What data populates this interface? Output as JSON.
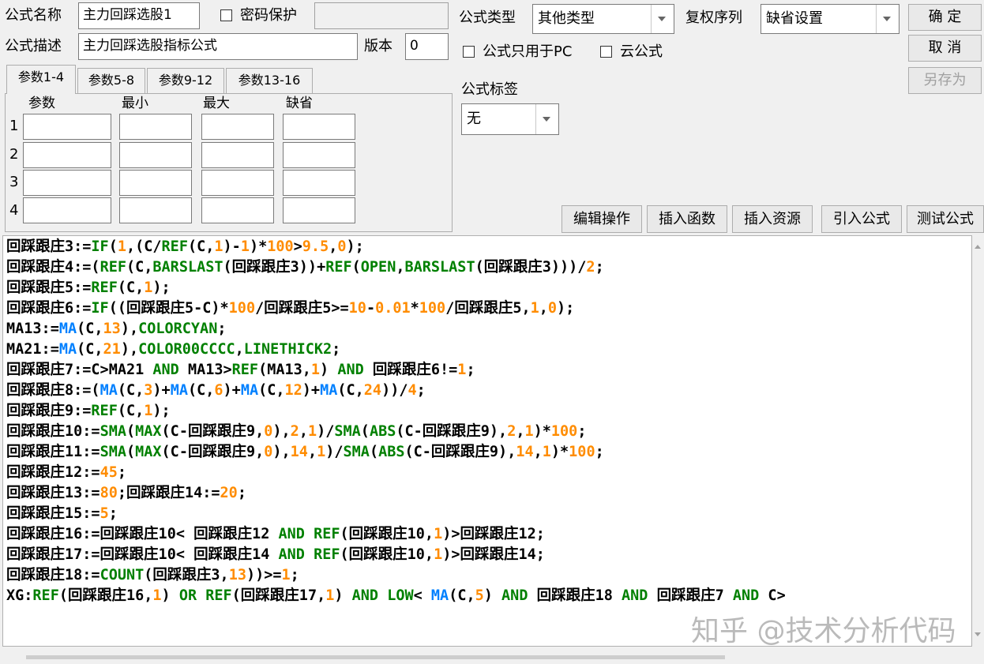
{
  "header": {
    "name_label": "公式名称",
    "name_value": "主力回踩选股1",
    "password_label": "密码保护",
    "password_value": "",
    "desc_label": "公式描述",
    "desc_value": "主力回踩选股指标公式",
    "version_label": "版本",
    "version_value": "0"
  },
  "right": {
    "type_label": "公式类型",
    "type_value": "其他类型",
    "restore_label": "复权序列",
    "restore_value": "缺省设置",
    "pc_only_label": "公式只用于PC",
    "cloud_label": "云公式",
    "tag_label": "公式标签",
    "tag_value": "无"
  },
  "buttons": {
    "ok": "确  定",
    "cancel": "取  消",
    "save_as": "另存为",
    "edit_ops": "编辑操作",
    "insert_func": "插入函数",
    "insert_res": "插入资源",
    "import_formula": "引入公式",
    "test_formula": "测试公式"
  },
  "params": {
    "tabs": [
      "参数1-4",
      "参数5-8",
      "参数9-12",
      "参数13-16"
    ],
    "columns": [
      "参数",
      "最小",
      "最大",
      "缺省"
    ],
    "rows": [
      "1",
      "2",
      "3",
      "4"
    ]
  },
  "code_lines": [
    [
      [
        "t",
        "回踩跟庄3:="
      ],
      [
        "k",
        "IF"
      ],
      [
        "t",
        "("
      ],
      [
        "n",
        "1"
      ],
      [
        "t",
        ",(C/"
      ],
      [
        "k",
        "REF"
      ],
      [
        "t",
        "(C,"
      ],
      [
        "n",
        "1"
      ],
      [
        "t",
        ")-"
      ],
      [
        "n",
        "1"
      ],
      [
        "t",
        ")*"
      ],
      [
        "n",
        "100"
      ],
      [
        "t",
        ">"
      ],
      [
        "n",
        "9.5"
      ],
      [
        "t",
        ","
      ],
      [
        "n",
        "0"
      ],
      [
        "t",
        ");"
      ]
    ],
    [
      [
        "t",
        "回踩跟庄4:=("
      ],
      [
        "k",
        "REF"
      ],
      [
        "t",
        "(C,"
      ],
      [
        "k",
        "BARSLAST"
      ],
      [
        "t",
        "(回踩跟庄3))+"
      ],
      [
        "k",
        "REF"
      ],
      [
        "t",
        "("
      ],
      [
        "k",
        "OPEN"
      ],
      [
        "t",
        ","
      ],
      [
        "k",
        "BARSLAST"
      ],
      [
        "t",
        "(回踩跟庄3)))/"
      ],
      [
        "n",
        "2"
      ],
      [
        "t",
        ";"
      ]
    ],
    [
      [
        "t",
        "回踩跟庄5:="
      ],
      [
        "k",
        "REF"
      ],
      [
        "t",
        "(C,"
      ],
      [
        "n",
        "1"
      ],
      [
        "t",
        ");"
      ]
    ],
    [
      [
        "t",
        "回踩跟庄6:="
      ],
      [
        "k",
        "IF"
      ],
      [
        "t",
        "((回踩跟庄5-C)*"
      ],
      [
        "n",
        "100"
      ],
      [
        "t",
        "/回踩跟庄5>="
      ],
      [
        "n",
        "10"
      ],
      [
        "t",
        "-"
      ],
      [
        "n",
        "0.01"
      ],
      [
        "t",
        "*"
      ],
      [
        "n",
        "100"
      ],
      [
        "t",
        "/回踩跟庄5,"
      ],
      [
        "n",
        "1"
      ],
      [
        "t",
        ","
      ],
      [
        "n",
        "0"
      ],
      [
        "t",
        ");"
      ]
    ],
    [
      [
        "t",
        "MA13:="
      ],
      [
        "f",
        "MA"
      ],
      [
        "t",
        "(C,"
      ],
      [
        "n",
        "13"
      ],
      [
        "t",
        "),"
      ],
      [
        "k",
        "COLORCYAN"
      ],
      [
        "t",
        ";"
      ]
    ],
    [
      [
        "t",
        "MA21:="
      ],
      [
        "f",
        "MA"
      ],
      [
        "t",
        "(C,"
      ],
      [
        "n",
        "21"
      ],
      [
        "t",
        "),"
      ],
      [
        "k",
        "COLOR00CCCC"
      ],
      [
        "t",
        ","
      ],
      [
        "k",
        "LINETHICK2"
      ],
      [
        "t",
        ";"
      ]
    ],
    [
      [
        "t",
        "回踩跟庄7:=C>MA21 "
      ],
      [
        "k",
        "AND"
      ],
      [
        "t",
        " MA13>"
      ],
      [
        "k",
        "REF"
      ],
      [
        "t",
        "(MA13,"
      ],
      [
        "n",
        "1"
      ],
      [
        "t",
        ") "
      ],
      [
        "k",
        "AND"
      ],
      [
        "t",
        " 回踩跟庄6!="
      ],
      [
        "n",
        "1"
      ],
      [
        "t",
        ";"
      ]
    ],
    [
      [
        "t",
        "回踩跟庄8:=("
      ],
      [
        "f",
        "MA"
      ],
      [
        "t",
        "(C,"
      ],
      [
        "n",
        "3"
      ],
      [
        "t",
        ")+"
      ],
      [
        "f",
        "MA"
      ],
      [
        "t",
        "(C,"
      ],
      [
        "n",
        "6"
      ],
      [
        "t",
        ")+"
      ],
      [
        "f",
        "MA"
      ],
      [
        "t",
        "(C,"
      ],
      [
        "n",
        "12"
      ],
      [
        "t",
        ")+"
      ],
      [
        "f",
        "MA"
      ],
      [
        "t",
        "(C,"
      ],
      [
        "n",
        "24"
      ],
      [
        "t",
        "))/"
      ],
      [
        "n",
        "4"
      ],
      [
        "t",
        ";"
      ]
    ],
    [
      [
        "t",
        "回踩跟庄9:="
      ],
      [
        "k",
        "REF"
      ],
      [
        "t",
        "(C,"
      ],
      [
        "n",
        "1"
      ],
      [
        "t",
        ");"
      ]
    ],
    [
      [
        "t",
        "回踩跟庄10:="
      ],
      [
        "k",
        "SMA"
      ],
      [
        "t",
        "("
      ],
      [
        "k",
        "MAX"
      ],
      [
        "t",
        "(C-回踩跟庄9,"
      ],
      [
        "n",
        "0"
      ],
      [
        "t",
        "),"
      ],
      [
        "n",
        "2"
      ],
      [
        "t",
        ","
      ],
      [
        "n",
        "1"
      ],
      [
        "t",
        ")/"
      ],
      [
        "k",
        "SMA"
      ],
      [
        "t",
        "("
      ],
      [
        "k",
        "ABS"
      ],
      [
        "t",
        "(C-回踩跟庄9),"
      ],
      [
        "n",
        "2"
      ],
      [
        "t",
        ","
      ],
      [
        "n",
        "1"
      ],
      [
        "t",
        ")*"
      ],
      [
        "n",
        "100"
      ],
      [
        "t",
        ";"
      ]
    ],
    [
      [
        "t",
        "回踩跟庄11:="
      ],
      [
        "k",
        "SMA"
      ],
      [
        "t",
        "("
      ],
      [
        "k",
        "MAX"
      ],
      [
        "t",
        "(C-回踩跟庄9,"
      ],
      [
        "n",
        "0"
      ],
      [
        "t",
        "),"
      ],
      [
        "n",
        "14"
      ],
      [
        "t",
        ","
      ],
      [
        "n",
        "1"
      ],
      [
        "t",
        ")/"
      ],
      [
        "k",
        "SMA"
      ],
      [
        "t",
        "("
      ],
      [
        "k",
        "ABS"
      ],
      [
        "t",
        "(C-回踩跟庄9),"
      ],
      [
        "n",
        "14"
      ],
      [
        "t",
        ","
      ],
      [
        "n",
        "1"
      ],
      [
        "t",
        ")*"
      ],
      [
        "n",
        "100"
      ],
      [
        "t",
        ";"
      ]
    ],
    [
      [
        "t",
        "回踩跟庄12:="
      ],
      [
        "n",
        "45"
      ],
      [
        "t",
        ";"
      ]
    ],
    [
      [
        "t",
        "回踩跟庄13:="
      ],
      [
        "n",
        "80"
      ],
      [
        "t",
        ";回踩跟庄14:="
      ],
      [
        "n",
        "20"
      ],
      [
        "t",
        ";"
      ]
    ],
    [
      [
        "t",
        "回踩跟庄15:="
      ],
      [
        "n",
        "5"
      ],
      [
        "t",
        ";"
      ]
    ],
    [
      [
        "t",
        "回踩跟庄16:=回踩跟庄10< 回踩跟庄12 "
      ],
      [
        "k",
        "AND"
      ],
      [
        "t",
        " "
      ],
      [
        "k",
        "REF"
      ],
      [
        "t",
        "(回踩跟庄10,"
      ],
      [
        "n",
        "1"
      ],
      [
        "t",
        ")>回踩跟庄12;"
      ]
    ],
    [
      [
        "t",
        "回踩跟庄17:=回踩跟庄10< 回踩跟庄14 "
      ],
      [
        "k",
        "AND"
      ],
      [
        "t",
        " "
      ],
      [
        "k",
        "REF"
      ],
      [
        "t",
        "(回踩跟庄10,"
      ],
      [
        "n",
        "1"
      ],
      [
        "t",
        ")>回踩跟庄14;"
      ]
    ],
    [
      [
        "t",
        "回踩跟庄18:="
      ],
      [
        "k",
        "COUNT"
      ],
      [
        "t",
        "(回踩跟庄3,"
      ],
      [
        "n",
        "13"
      ],
      [
        "t",
        "))>="
      ],
      [
        "n",
        "1"
      ],
      [
        "t",
        ";"
      ]
    ],
    [
      [
        "t",
        "XG:"
      ],
      [
        "k",
        "REF"
      ],
      [
        "t",
        "(回踩跟庄16,"
      ],
      [
        "n",
        "1"
      ],
      [
        "t",
        ") "
      ],
      [
        "k",
        "OR"
      ],
      [
        "t",
        " "
      ],
      [
        "k",
        "REF"
      ],
      [
        "t",
        "(回踩跟庄17,"
      ],
      [
        "n",
        "1"
      ],
      [
        "t",
        ") "
      ],
      [
        "k",
        "AND"
      ],
      [
        "t",
        " "
      ],
      [
        "k",
        "LOW"
      ],
      [
        "t",
        "< "
      ],
      [
        "f",
        "MA"
      ],
      [
        "t",
        "(C,"
      ],
      [
        "n",
        "5"
      ],
      [
        "t",
        ") "
      ],
      [
        "k",
        "AND"
      ],
      [
        "t",
        " 回踩跟庄18 "
      ],
      [
        "k",
        "AND"
      ],
      [
        "t",
        " 回踩跟庄7 "
      ],
      [
        "k",
        "AND"
      ],
      [
        "t",
        " C>"
      ]
    ]
  ],
  "watermark": "知乎 @技术分析代码",
  "colors": {
    "keyword": "#008000",
    "number": "#ff8c00",
    "function": "#0080ff"
  }
}
